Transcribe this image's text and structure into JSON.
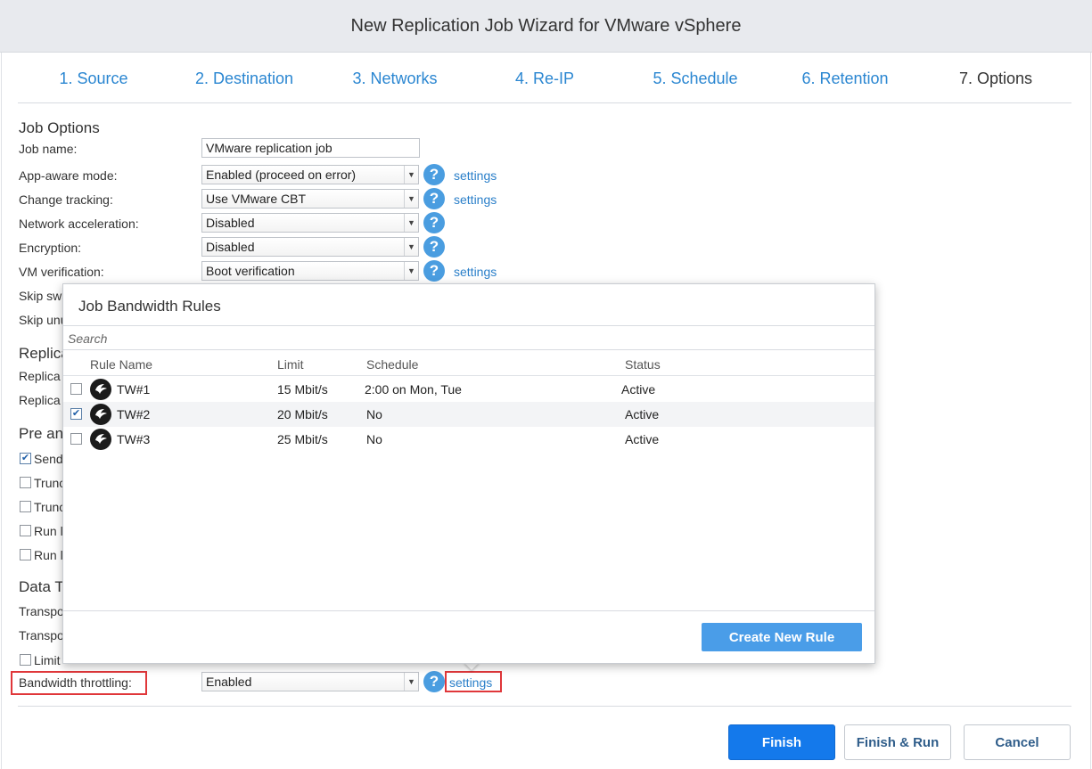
{
  "window": {
    "title": "New Replication Job Wizard for VMware vSphere"
  },
  "steps": [
    {
      "label": "1. Source"
    },
    {
      "label": "2. Destination"
    },
    {
      "label": "3. Networks"
    },
    {
      "label": "4. Re-IP"
    },
    {
      "label": "5. Schedule"
    },
    {
      "label": "6. Retention"
    },
    {
      "label": "7. Options"
    }
  ],
  "job_options": {
    "section_title": "Job Options",
    "job_name_label": "Job name:",
    "job_name_value": "VMware replication job",
    "app_aware_label": "App-aware mode:",
    "app_aware_value": "Enabled (proceed on error)",
    "change_tracking_label": "Change tracking:",
    "change_tracking_value": "Use VMware CBT",
    "network_accel_label": "Network acceleration:",
    "network_accel_value": "Disabled",
    "encryption_label": "Encryption:",
    "encryption_value": "Disabled",
    "vm_verification_label": "VM verification:",
    "vm_verification_value": "Boot verification",
    "skip_swap_label": "Skip swa",
    "skip_unused_label": "Skip unu",
    "settings_link": "settings"
  },
  "replica_section": {
    "title": "Replica",
    "row1": "Replica",
    "row2": "Replica"
  },
  "pre_post_section": {
    "title": "Pre an",
    "send": "Send",
    "trunc1": "Trunc",
    "trunc2": "Trunc",
    "run1": "Run l",
    "run2": "Run l"
  },
  "data_transfer": {
    "title": "Data T",
    "transport1": "Transpo",
    "transport2": "Transpo",
    "limit": "Limit",
    "bandwidth_label": "Bandwidth throttling:",
    "bandwidth_value": "Enabled",
    "settings_link": "settings"
  },
  "popup": {
    "title": "Job Bandwidth Rules",
    "search_placeholder": "Search",
    "columns": {
      "name": "Rule Name",
      "limit": "Limit",
      "schedule": "Schedule",
      "status": "Status"
    },
    "rules": [
      {
        "name": "TW#1",
        "limit": "15 Mbit/s",
        "schedule": "2:00 on Mon, Tue",
        "status": "Active",
        "checked": false
      },
      {
        "name": "TW#2",
        "limit": "20 Mbit/s",
        "schedule": "No",
        "status": "Active",
        "checked": true
      },
      {
        "name": "TW#3",
        "limit": "25 Mbit/s",
        "schedule": "No",
        "status": "Active",
        "checked": false
      }
    ],
    "create_button": "Create New Rule"
  },
  "footer": {
    "finish": "Finish",
    "finish_run": "Finish & Run",
    "cancel": "Cancel"
  },
  "colors": {
    "accent": "#1479eb",
    "link": "#2a86d1",
    "help_icon": "#4a9de0",
    "highlight": "#e0373a"
  },
  "icons": {
    "help": "?",
    "dropdown": "▼",
    "checkmark": "✔",
    "rule": "throttle-rule-icon"
  }
}
